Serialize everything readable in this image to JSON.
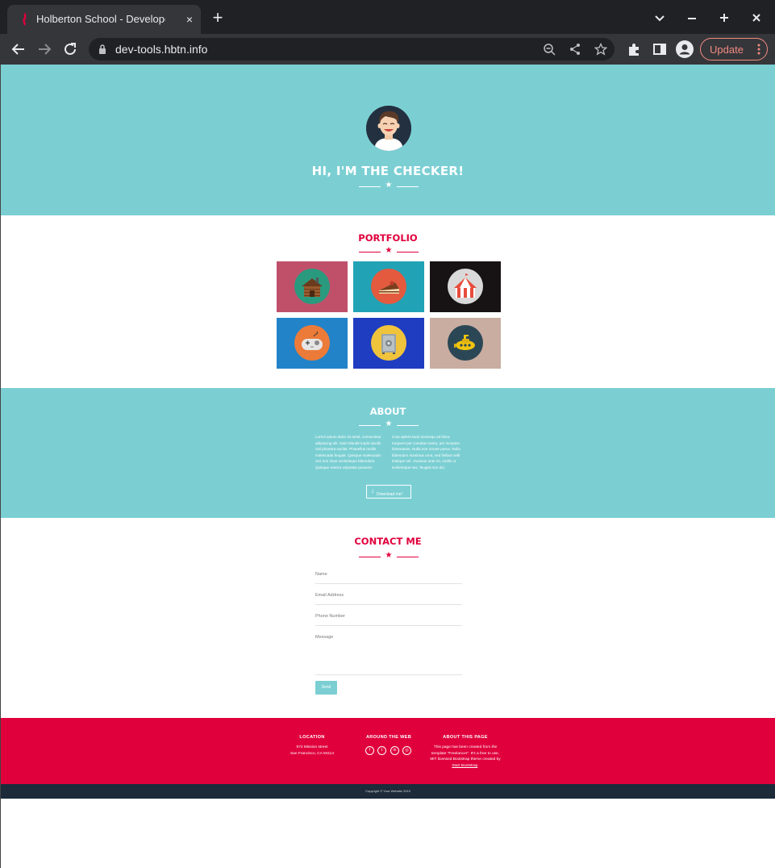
{
  "browser": {
    "tab_title": "Holberton School - Developer",
    "tab_close": "×",
    "new_tab": "+",
    "url": "dev-tools.hbtn.info",
    "update_label": "Update"
  },
  "header": {
    "title": "HI, I'M THE CHECKER!"
  },
  "portfolio": {
    "title": "PORTFOLIO",
    "items": [
      {
        "icon": "cabin-icon",
        "bg": "#c0506a",
        "circle": "#2a9a7e"
      },
      {
        "icon": "cake-icon",
        "bg": "#21a2b5",
        "circle": "#e35a3e"
      },
      {
        "icon": "circus-tent-icon",
        "bg": "#171314",
        "circle": "#d9d9d9"
      },
      {
        "icon": "game-controller-icon",
        "bg": "#2283c9",
        "circle": "#ec7b39"
      },
      {
        "icon": "safe-icon",
        "bg": "#1f3dc0",
        "circle": "#f0c33c"
      },
      {
        "icon": "submarine-icon",
        "bg": "#c9ada0",
        "circle": "#2b4755"
      }
    ]
  },
  "about": {
    "title": "ABOUT",
    "col1": "Lorem ipsum dolor sit amet, consectetur adipiscing elit. Nam blandit turpis iaculis nisl pharetra sacilar. Phasellus mollis malesuada feugiat. Quisque malesuada orci non risus scelerisque bibendum. Quisque viverra vulputate posuere.",
    "col2": "Cras aptent taciti sociosqu ad litora torquent per conubia nostra, per inceptos himenaeos. Nulla non ornare purus. Nulla bibendum maximus urna, sed finibus velit tristique vel. Vivamus ante mi, mollis ut scelerisque nec, feugiat non dui.",
    "download_label": "Download me!"
  },
  "contact": {
    "title": "CONTACT ME",
    "name_placeholder": "Name",
    "email_placeholder": "Email Address",
    "phone_placeholder": "Phone Number",
    "message_placeholder": "Message",
    "send_label": "Send"
  },
  "footer": {
    "location_heading": "LOCATION",
    "location_line1": "972 Mission street",
    "location_line2": "San Francisco, CA 94114",
    "web_heading": "AROUND THE WEB",
    "about_heading": "ABOUT THIS PAGE",
    "about_text": "This page has been created from the template \"Freelancer\". It's a free to use, MIT licensed Bootstrap theme created by",
    "about_link": "Start Bootstrap",
    "about_end": ".",
    "copyright": "Copyright © Your Website 2019",
    "social": [
      "f",
      "t",
      "in",
      "◎"
    ]
  },
  "colors": {
    "teal": "#7bcfd3",
    "crimson": "#e0003c",
    "navy": "#1c2a3a"
  }
}
